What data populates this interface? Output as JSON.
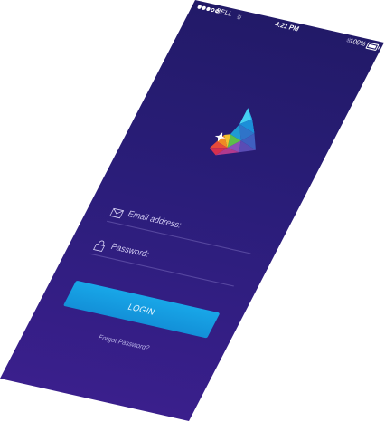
{
  "status_bar": {
    "carrier": "BELL",
    "time": "4:21 PM",
    "battery": "100%",
    "signal_icon": "signal-dots-icon",
    "wifi_icon": "wifi-icon",
    "bluetooth_icon": "bluetooth-icon",
    "battery_icon": "battery-icon"
  },
  "logo": {
    "icon": "triangle-logo-icon"
  },
  "form": {
    "email_placeholder": "Email address:",
    "email_icon": "envelope-icon",
    "password_placeholder": "Password:",
    "password_icon": "lock-icon",
    "login_label": "LOGIN",
    "forgot_label": "Forgot Password?"
  },
  "colors": {
    "background_top": "#221a68",
    "background_bottom": "#3a1f8c",
    "button": "#1a9de0"
  }
}
